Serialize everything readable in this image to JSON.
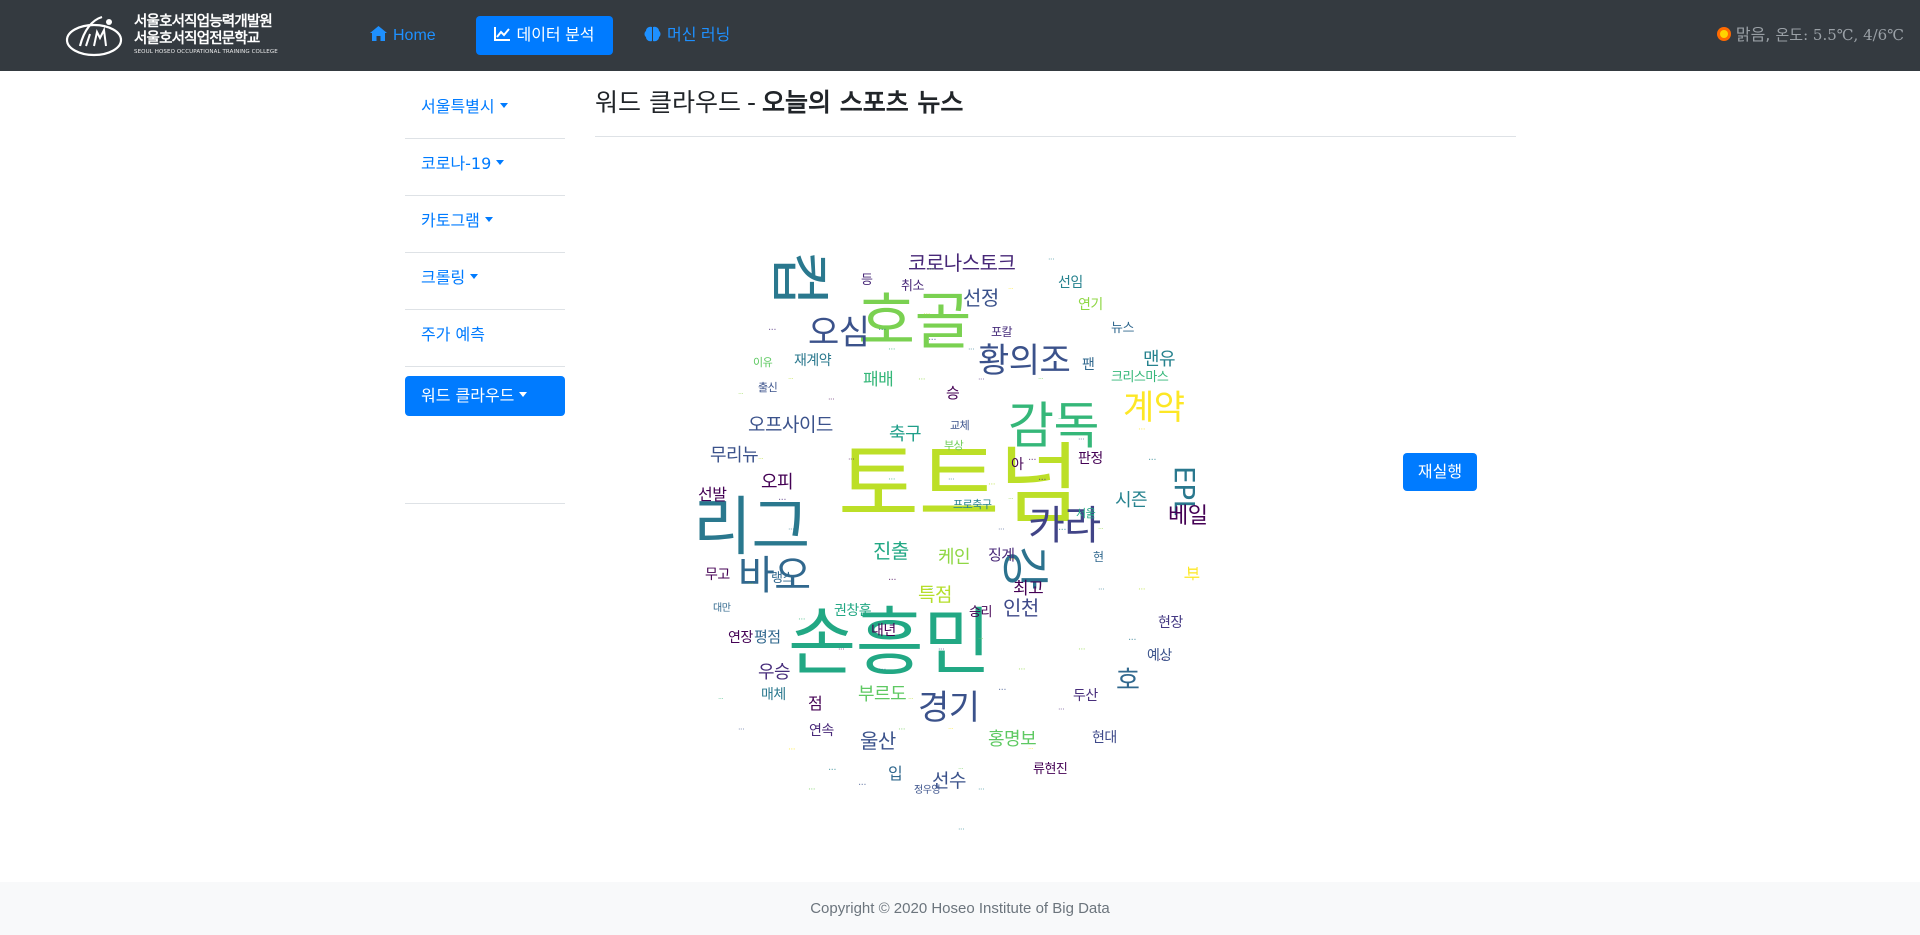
{
  "brand": {
    "line1": "서울호서직업능력개발원",
    "line2": "서울호서직업전문학교",
    "line3": "SEOUL HOSEO OCCUPATIONAL TRAINING COLLEGE"
  },
  "nav": {
    "home": "Home",
    "data_analysis": "데이터 분석",
    "machine_learning": "머신 러닝"
  },
  "weather": {
    "condition": "맑음,",
    "temp": "온도: 5.5℃, 4/6℃"
  },
  "sidebar": {
    "items": [
      {
        "label": "서울특별시",
        "dropdown": true
      },
      {
        "label": "코로나-19",
        "dropdown": true
      },
      {
        "label": "카토그램",
        "dropdown": true
      },
      {
        "label": "크롤링",
        "dropdown": true
      },
      {
        "label": "주가 예측",
        "dropdown": false
      },
      {
        "label": "워드 클라우드",
        "dropdown": true,
        "active": true
      }
    ]
  },
  "page": {
    "title_prefix": "워드 클라우드",
    "title_sep": "-",
    "title_main": "오늘의 스포츠 뉴스"
  },
  "cloud": {
    "words": [
      {
        "text": "토트넘",
        "color": "#bcdf27"
      },
      {
        "text": "손흥민",
        "color": "#22a884"
      },
      {
        "text": "리그",
        "color": "#2a788e"
      },
      {
        "text": "호골",
        "color": "#7ad151"
      },
      {
        "text": "컵",
        "color": "#2a788e"
      },
      {
        "text": "감독",
        "color": "#35b779"
      },
      {
        "text": "강",
        "color": "#2c728e"
      },
      {
        "text": "카라",
        "color": "#414487"
      },
      {
        "text": "바오",
        "color": "#31688e"
      },
      {
        "text": "계약",
        "color": "#fde725"
      },
      {
        "text": "황의조",
        "color": "#3b528b"
      },
      {
        "text": "경기",
        "color": "#3b528b"
      },
      {
        "text": "오심",
        "color": "#3b528b"
      },
      {
        "text": "EPL",
        "color": "#2a788e"
      },
      {
        "text": "코로나스토크",
        "color": "#482878"
      },
      {
        "text": "오프사이드",
        "color": "#3b528b"
      },
      {
        "text": "베일",
        "color": "#440154"
      },
      {
        "text": "맨유",
        "color": "#26828e"
      },
      {
        "text": "선정",
        "color": "#3b528b"
      },
      {
        "text": "울산",
        "color": "#3b528b"
      },
      {
        "text": "홍명보",
        "color": "#5ec962"
      },
      {
        "text": "진출",
        "color": "#22a884"
      },
      {
        "text": "패배",
        "color": "#35b779"
      },
      {
        "text": "승",
        "color": "#440154"
      },
      {
        "text": "특점",
        "color": "#b5de2b"
      },
      {
        "text": "시즌",
        "color": "#26828e"
      },
      {
        "text": "인천",
        "color": "#3e4989"
      },
      {
        "text": "우승",
        "color": "#472d7b"
      },
      {
        "text": "호",
        "color": "#31688e"
      },
      {
        "text": "선수",
        "color": "#3b528b"
      },
      {
        "text": "무리뉴",
        "color": "#3b528b"
      },
      {
        "text": "축구",
        "color": "#1f9e89"
      },
      {
        "text": "오피",
        "color": "#440154"
      },
      {
        "text": "케인",
        "color": "#8fd744"
      },
      {
        "text": "최고",
        "color": "#440154"
      },
      {
        "text": "선발",
        "color": "#440154"
      },
      {
        "text": "재계약",
        "color": "#2a788e"
      },
      {
        "text": "부르도",
        "color": "#5ec962"
      },
      {
        "text": "내년",
        "color": "#440154"
      },
      {
        "text": "평점",
        "color": "#31688e"
      },
      {
        "text": "연속",
        "color": "#482878"
      },
      {
        "text": "류현진",
        "color": "#440154"
      },
      {
        "text": "두산",
        "color": "#472d7b"
      },
      {
        "text": "권창훈",
        "color": "#22a884"
      },
      {
        "text": "연장",
        "color": "#440154"
      },
      {
        "text": "매체",
        "color": "#2a788e"
      },
      {
        "text": "현장",
        "color": "#443983"
      },
      {
        "text": "판정",
        "color": "#440154"
      },
      {
        "text": "선임",
        "color": "#26828e"
      },
      {
        "text": "뉴스",
        "color": "#31688e"
      },
      {
        "text": "취소",
        "color": "#482878"
      },
      {
        "text": "현대",
        "color": "#3e4989"
      },
      {
        "text": "연기",
        "color": "#8fd744"
      },
      {
        "text": "무고",
        "color": "#440154"
      },
      {
        "text": "랭스",
        "color": "#31688e"
      },
      {
        "text": "예상",
        "color": "#3b528b"
      },
      {
        "text": "팬",
        "color": "#31688e"
      },
      {
        "text": "포칼",
        "color": "#472d7b"
      },
      {
        "text": "승리",
        "color": "#440154"
      },
      {
        "text": "이유",
        "color": "#5ec962"
      },
      {
        "text": "출신",
        "color": "#3b528b"
      },
      {
        "text": "교체",
        "color": "#3b528b"
      },
      {
        "text": "크리스마스",
        "color": "#35b779"
      },
      {
        "text": "부상",
        "color": "#6ece58"
      },
      {
        "text": "등",
        "color": "#482878"
      },
      {
        "text": "입",
        "color": "#31688e"
      },
      {
        "text": "점",
        "color": "#440154"
      },
      {
        "text": "아",
        "color": "#440154"
      },
      {
        "text": "파",
        "color": "#fde725"
      },
      {
        "text": "정우영",
        "color": "#3b528b"
      },
      {
        "text": "징계",
        "color": "#482878"
      },
      {
        "text": "프로축구",
        "color": "#26828e"
      },
      {
        "text": "대만",
        "color": "#31688e"
      },
      {
        "text": "현",
        "color": "#31688e"
      },
      {
        "text": "서울",
        "color": "#22a884"
      }
    ]
  },
  "rerun_button": "재실행",
  "footer": {
    "copyright": "Copyright © 2020 Hoseo Institute of Big Data"
  }
}
